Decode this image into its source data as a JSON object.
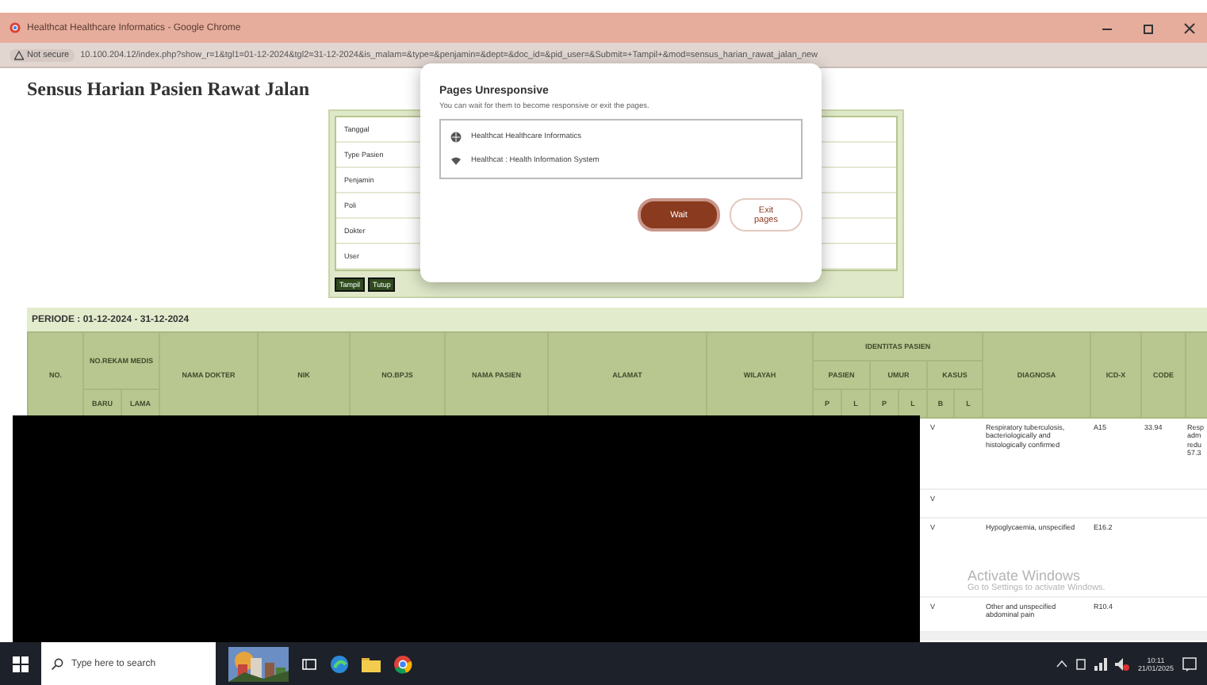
{
  "browser": {
    "title": "Healthcat Healthcare Informatics - Google Chrome",
    "security": "Not secure",
    "url": "10.100.204.12/index.php?show_r=1&tgl1=01-12-2024&tgl2=31-12-2024&is_malam=&type=&penjamin=&dept=&doc_id=&pid_user=&Submit=+Tampil+&mod=sensus_harian_rawat_jalan_new"
  },
  "page": {
    "heading": "Sensus Harian Pasien Rawat Jalan",
    "filter_form": {
      "fields": [
        "Tanggal",
        "Type Pasien",
        "Penjamin",
        "Poli",
        "Dokter",
        "User"
      ],
      "buttons": [
        "Tampil",
        "Tutup"
      ]
    },
    "period": "PERIODE : 01-12-2024 - 31-12-2024",
    "table": {
      "columns": [
        {
          "label": "NO."
        },
        {
          "label": "NO.REKAM MEDIS",
          "sub": [
            "BARU",
            "LAMA"
          ]
        },
        {
          "label": "NAMA DOKTER"
        },
        {
          "label": "NIK"
        },
        {
          "label": "NO.BPJS"
        },
        {
          "label": "NAMA PASIEN"
        },
        {
          "label": "ALAMAT"
        },
        {
          "label": "WILAYAH"
        },
        {
          "label": "IDENTITAS PASIEN",
          "groups": [
            {
              "label": "PASIEN",
              "sub": [
                "P",
                "L"
              ]
            },
            {
              "label": "UMUR",
              "sub": [
                "P",
                "L"
              ]
            },
            {
              "label": "KASUS",
              "sub": [
                "B",
                "L"
              ]
            }
          ]
        },
        {
          "label": "DIAGNOSA"
        },
        {
          "label": "ICD-X"
        },
        {
          "label": "CODE"
        }
      ],
      "rows": [
        {
          "kasus_b": "V",
          "diagnosa": "Respiratory tuberculosis, bacteriologically and histologically confirmed",
          "icd_x": "A15",
          "code": "33.94",
          "column_19": "Resp\nadm\nredu\n57.3"
        },
        {
          "kasus_b": "V"
        },
        {
          "kasus_b": "V",
          "diagnosa": "Hypoglycaemia, unspecified",
          "icd_x": "E16.2"
        },
        {
          "kasus_b": "V",
          "diagnosa": "Other and unspecified abdominal pain",
          "icd_x": "R10.4"
        }
      ]
    }
  },
  "dialog": {
    "title": "Pages Unresponsive",
    "message": "You can wait for them to become responsive or exit the pages.",
    "pages": [
      {
        "name": "Healthcat Healthcare Informatics",
        "kind": "globe"
      },
      {
        "name": "Healthcat : Health Information System",
        "kind": "wifi"
      }
    ],
    "buttons": [
      {
        "label": "Wait",
        "kind": "primary"
      },
      {
        "label": "Exit pages",
        "kind": "secondary"
      }
    ]
  },
  "activation_notice": {
    "title": "Activate Windows",
    "message": "Go to Settings to activate Windows."
  },
  "taskbar": {
    "search_placeholder": "Type here to search",
    "time": "10:11",
    "date": "21/01/2025"
  }
}
